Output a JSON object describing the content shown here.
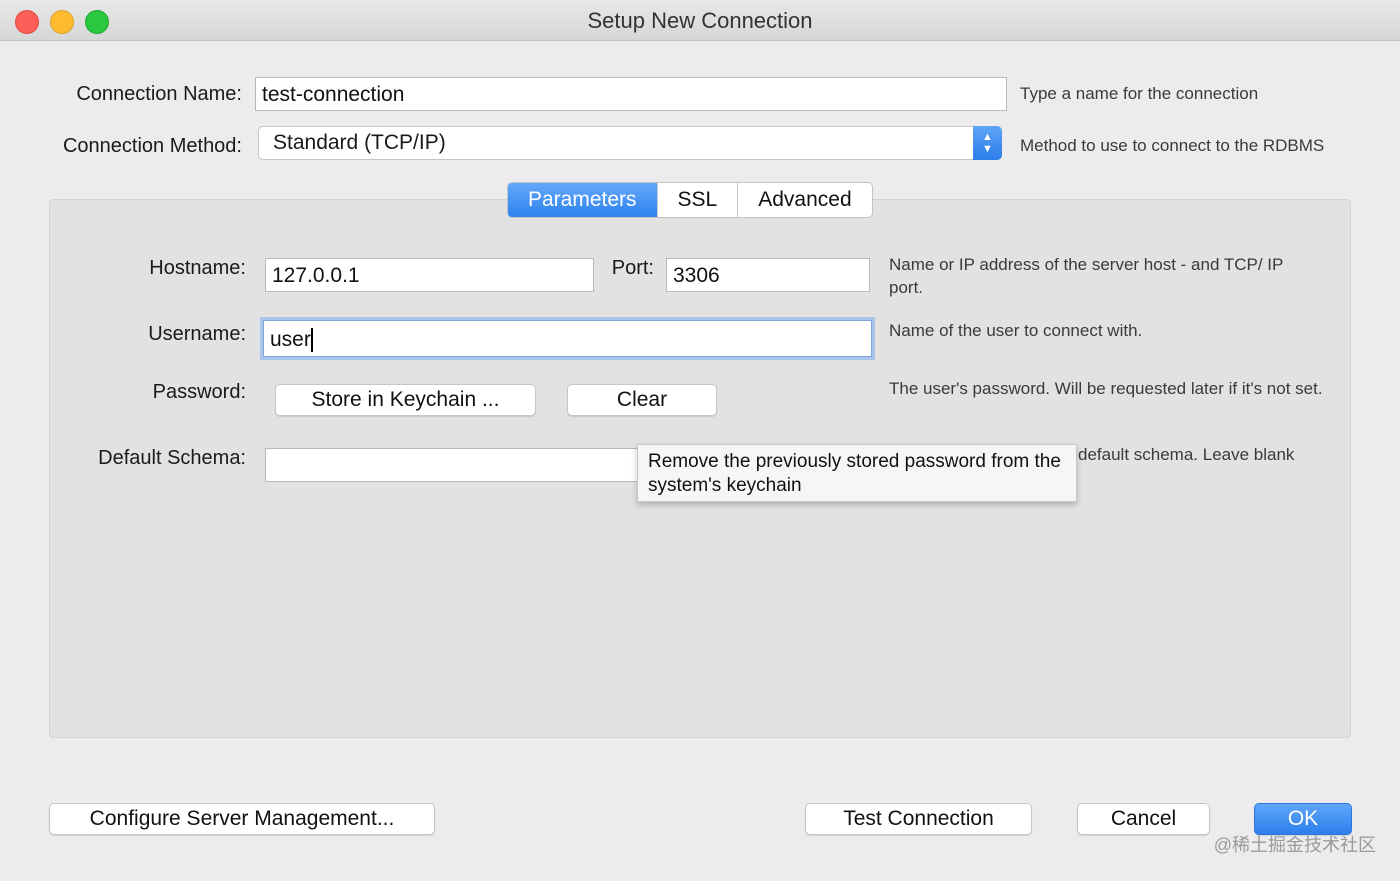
{
  "window": {
    "title": "Setup New Connection"
  },
  "connection_name": {
    "label": "Connection Name:",
    "value": "test-connection",
    "hint": "Type a name for the connection"
  },
  "connection_method": {
    "label": "Connection Method:",
    "value": "Standard (TCP/IP)",
    "hint": "Method to use to connect to the RDBMS"
  },
  "tabs": [
    {
      "label": "Parameters",
      "active": true
    },
    {
      "label": "SSL",
      "active": false
    },
    {
      "label": "Advanced",
      "active": false
    }
  ],
  "parameters": {
    "hostname": {
      "label": "Hostname:",
      "value": "127.0.0.1"
    },
    "port": {
      "label": "Port:",
      "value": "3306"
    },
    "host_hint": "Name or IP address of the server host - and TCP/ IP port.",
    "username": {
      "label": "Username:",
      "value": "user",
      "hint": "Name of the user to connect with."
    },
    "password": {
      "label": "Password:",
      "store_label": "Store in Keychain ...",
      "clear_label": "Clear",
      "hint": "The user's password. Will be requested later if it's not set."
    },
    "default_schema": {
      "label": "Default Schema:",
      "value": "",
      "hint_visible": "default schema. Leave blank"
    }
  },
  "tooltip": {
    "text": "Remove the previously stored password from the system's keychain"
  },
  "footer": {
    "configure_label": "Configure Server Management...",
    "test_label": "Test Connection",
    "cancel_label": "Cancel",
    "ok_label": "OK"
  },
  "watermark": "@稀土掘金技术社区",
  "colors": {
    "accent": "#2f82ee",
    "focus_ring": "#a9c6ea"
  }
}
